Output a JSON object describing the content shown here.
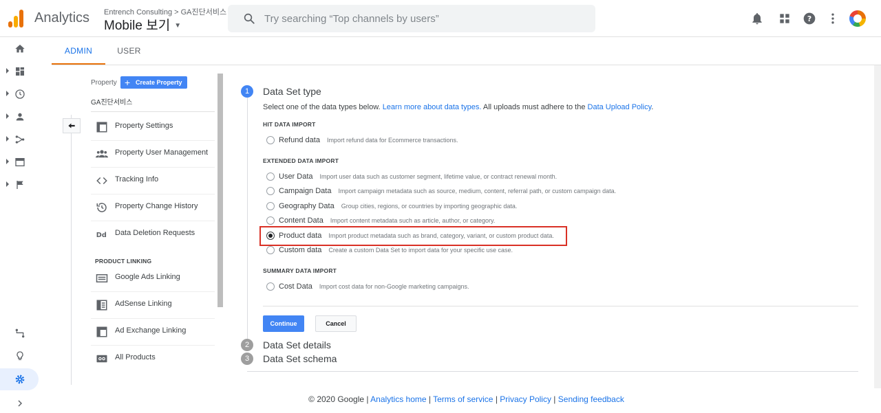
{
  "header": {
    "app_name": "Analytics",
    "breadcrumb": "Entrench Consulting > GA진단서비스",
    "view_name": "Mobile 보기",
    "search_placeholder": "Try searching “Top channels by users”"
  },
  "tabs": {
    "admin": "ADMIN",
    "user": "USER"
  },
  "property_panel": {
    "label": "Property",
    "create_button": "Create Property",
    "property_name": "GA진단서비스",
    "items": [
      {
        "label": "Property Settings",
        "icon": "settings-page-icon"
      },
      {
        "label": "Property User Management",
        "icon": "people-icon"
      },
      {
        "label": "Tracking Info",
        "icon": "code-icon"
      },
      {
        "label": "Property Change History",
        "icon": "history-icon"
      },
      {
        "label": "Data Deletion Requests",
        "icon": "dd-icon"
      }
    ],
    "linking_title": "PRODUCT LINKING",
    "linking_items": [
      {
        "label": "Google Ads Linking",
        "icon": "google-ads-icon"
      },
      {
        "label": "AdSense Linking",
        "icon": "adsense-icon"
      },
      {
        "label": "Ad Exchange Linking",
        "icon": "ad-exchange-icon"
      },
      {
        "label": "All Products",
        "icon": "all-products-icon"
      }
    ]
  },
  "wizard": {
    "step1": {
      "number": "1",
      "title": "Data Set type"
    },
    "desc": {
      "prefix": "Select one of the data types below. ",
      "learn_more": "Learn more about data types.",
      "middle": " All uploads must adhere to the ",
      "policy": "Data Upload Policy",
      "suffix": "."
    },
    "hit_title": "HIT DATA IMPORT",
    "extended_title": "EXTENDED DATA IMPORT",
    "summary_title": "SUMMARY DATA IMPORT",
    "options": {
      "refund": {
        "label": "Refund data",
        "desc": "Import refund data for Ecommerce transactions."
      },
      "user": {
        "label": "User Data",
        "desc": "Import user data such as customer segment, lifetime value, or contract renewal month."
      },
      "campaign": {
        "label": "Campaign Data",
        "desc": "Import campaign metadata such as source, medium, content, referral path, or custom campaign data."
      },
      "geography": {
        "label": "Geography Data",
        "desc": "Group cities, regions, or countries by importing geographic data."
      },
      "content": {
        "label": "Content Data",
        "desc": "Import content metadata such as article, author, or category."
      },
      "product": {
        "label": "Product data",
        "desc": "Import product metadata such as brand, category, variant, or custom product data."
      },
      "custom": {
        "label": "Custom data",
        "desc": "Create a custom Data Set to import data for your specific use case."
      },
      "cost": {
        "label": "Cost Data",
        "desc": "Import cost data for non-Google marketing campaigns."
      }
    },
    "selected": "product",
    "continue_button": "Continue",
    "cancel_button": "Cancel",
    "step2": {
      "number": "2",
      "title": "Data Set details"
    },
    "step3": {
      "number": "3",
      "title": "Data Set schema"
    }
  },
  "footer": {
    "copyright": "© 2020 Google",
    "sep": " | ",
    "links": [
      "Analytics home",
      "Terms of service",
      "Privacy Policy",
      "Sending feedback"
    ]
  },
  "colors": {
    "accent": "#1a73e8",
    "button_blue": "#4285f4",
    "highlight_red": "#d93025",
    "tab_underline": "#e8710a"
  }
}
